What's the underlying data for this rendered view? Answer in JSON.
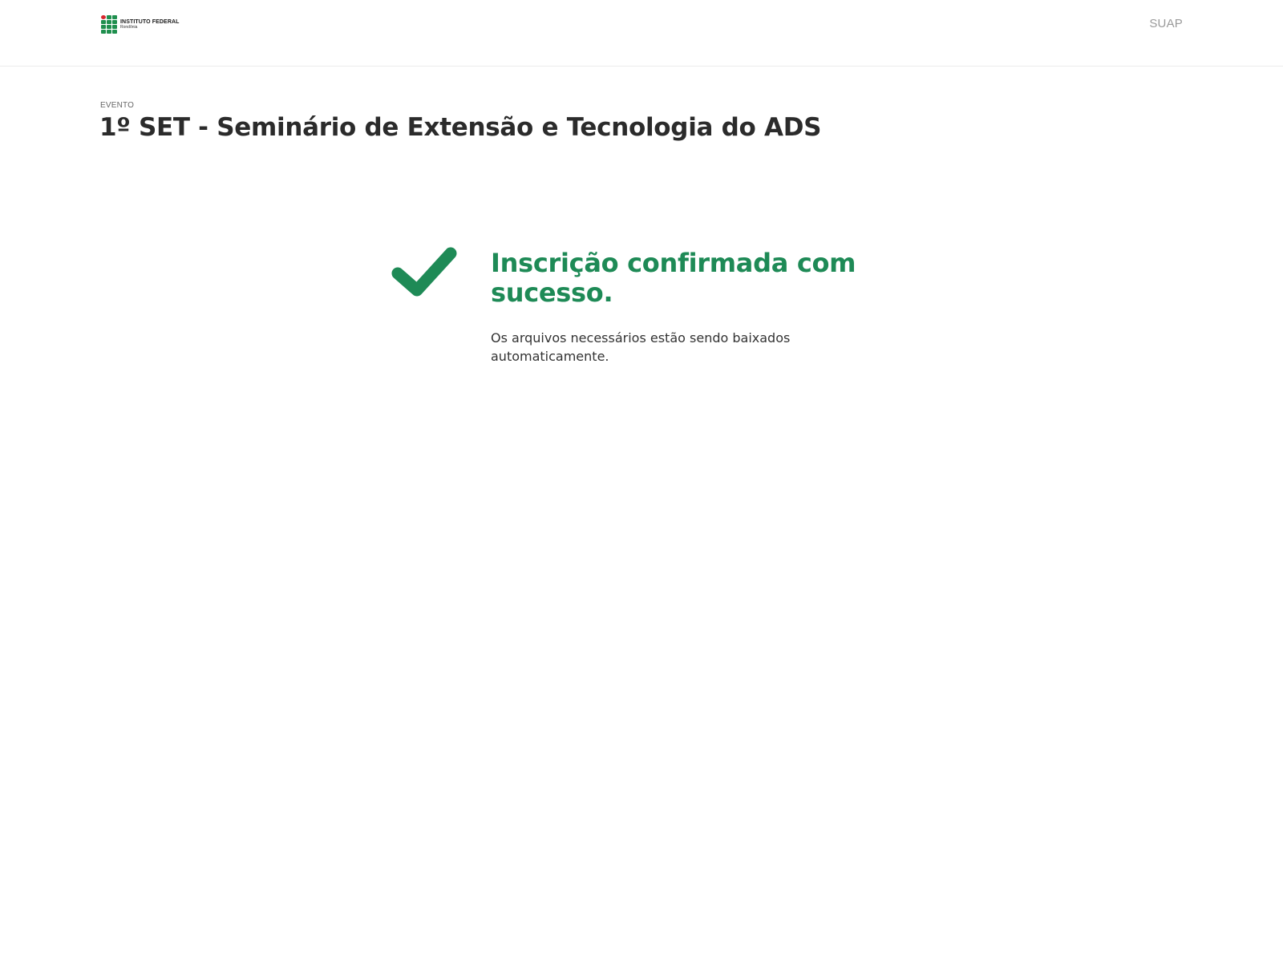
{
  "header": {
    "logo": {
      "name": "INSTITUTO FEDERAL",
      "campus": "Rondônia"
    },
    "nav_link": "SUAP"
  },
  "page": {
    "eyebrow": "EVENTO",
    "title": "1º SET - Seminário de Extensão e Tecnologia do ADS"
  },
  "confirmation": {
    "icon": "check-icon",
    "title": "Inscrição confirmada com sucesso.",
    "message": "Os arquivos necessários estão sendo baixados automaticamente."
  },
  "colors": {
    "success_green": "#1e8a56",
    "logo_green": "#1f8f4e",
    "logo_red": "#d7262e",
    "nav_gray": "#9a9a9a"
  }
}
